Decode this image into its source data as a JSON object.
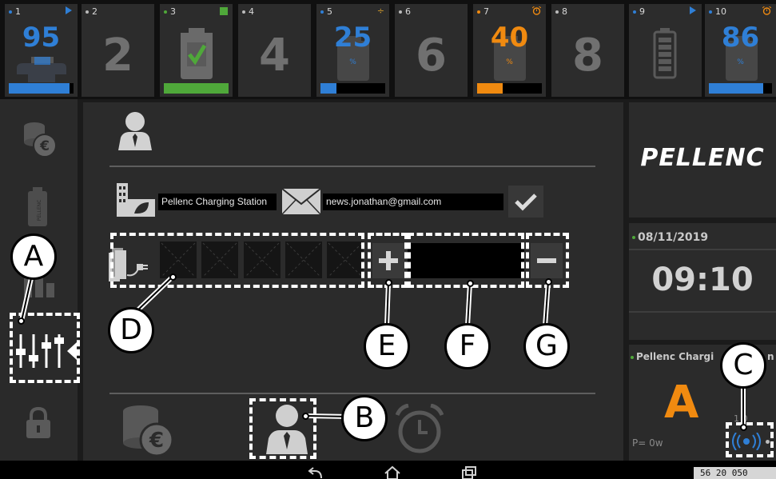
{
  "slots": [
    {
      "num": "1",
      "value": "95",
      "status_color": "#2f7fd6",
      "dot_color": "#2f7fd6",
      "level": 0.95,
      "fill_color": "#2f7fd6"
    },
    {
      "num": "2",
      "value": "2"
    },
    {
      "num": "3",
      "status_color": "#4fa83a",
      "dot_color": "#4fa83a",
      "fill_color": "#4fa83a",
      "level": 1.0
    },
    {
      "num": "4",
      "value": "4"
    },
    {
      "num": "5",
      "value": "25",
      "pct": "%",
      "dot_color": "#2f7fd6",
      "status_color": "#d29a2a",
      "fill_color": "#2f7fd6",
      "level": 0.25
    },
    {
      "num": "6",
      "value": "6"
    },
    {
      "num": "7",
      "value": "40",
      "pct": "%",
      "dot_color": "#f08a10",
      "status_color": "#f08a10",
      "fill_color": "#f08a10",
      "level": 0.4
    },
    {
      "num": "8",
      "value": "8"
    },
    {
      "num": "9",
      "dot_color": "#2f7fd6",
      "status_color": "#2f7fd6"
    },
    {
      "num": "10",
      "value": "86",
      "pct": "%",
      "dot_color": "#2f7fd6",
      "status_color": "#f08a10",
      "fill_color": "#2f7fd6",
      "level": 0.86
    }
  ],
  "form": {
    "station_name": "Pellenc Charging Station",
    "email": "news.jonathan@gmail.com"
  },
  "brand": {
    "logo_text": "PELLENC"
  },
  "clock": {
    "date": "08/11/2019",
    "time": "09:10"
  },
  "station": {
    "name": "Pellenc Chargi",
    "name_tail": "n",
    "letter": "A",
    "power": "P= 0w",
    "count": "1 0"
  },
  "status_bar": {
    "text": "56  20  050"
  },
  "callouts": {
    "a": "A",
    "b": "B",
    "c": "C",
    "d": "D",
    "e": "E",
    "f": "F",
    "g": "G"
  },
  "colors": {
    "accent": "#f08a10",
    "blue": "#2f7fd6",
    "green": "#4fa83a",
    "panel": "#2b2b2b"
  }
}
